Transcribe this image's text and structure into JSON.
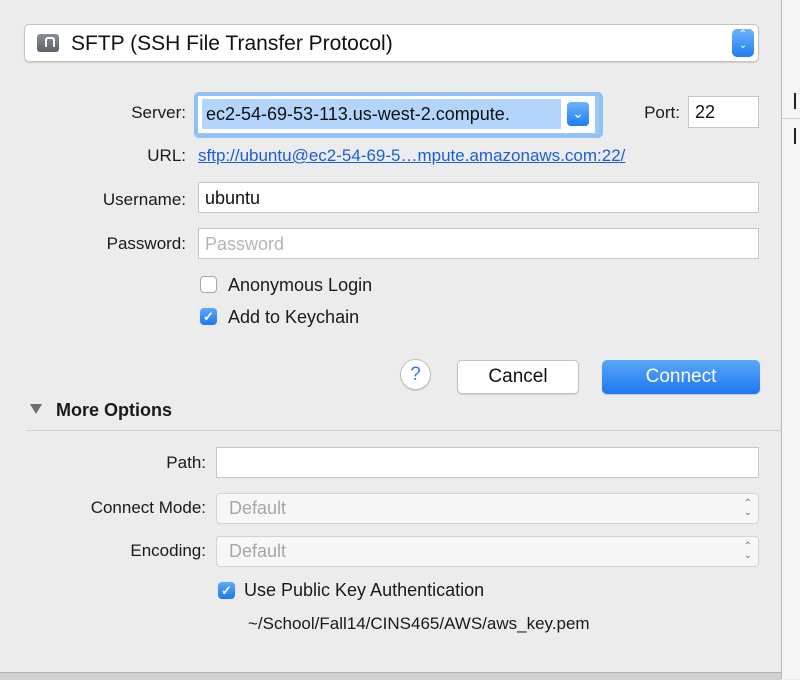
{
  "protocol": {
    "label": "SFTP (SSH File Transfer Protocol)"
  },
  "server": {
    "label": "Server:",
    "value": "ec2-54-69-53-113.us-west-2.compute."
  },
  "port": {
    "label": "Port:",
    "value": "22"
  },
  "url": {
    "label": "URL:",
    "link": "sftp://ubuntu@ec2-54-69-5…mpute.amazonaws.com:22/"
  },
  "username": {
    "label": "Username:",
    "value": "ubuntu"
  },
  "password": {
    "label": "Password:",
    "placeholder": "Password"
  },
  "options": {
    "anonymous": {
      "label": "Anonymous Login",
      "checked": false
    },
    "keychain": {
      "label": "Add to Keychain",
      "checked": true
    }
  },
  "buttons": {
    "help": "?",
    "cancel": "Cancel",
    "connect": "Connect"
  },
  "more_options": {
    "title": "More Options",
    "path": {
      "label": "Path:",
      "value": ""
    },
    "connect_mode": {
      "label": "Connect Mode:",
      "value": "Default"
    },
    "encoding": {
      "label": "Encoding:",
      "value": "Default"
    },
    "public_key": {
      "label": "Use Public Key Authentication",
      "checked": true,
      "key_file": "~/School/Fall14/CINS465/AWS/aws_key.pem"
    }
  },
  "colors": {
    "accent": "#1f7ff0",
    "link": "#1a5fd6",
    "focus_ring": "#8fc1f5"
  }
}
